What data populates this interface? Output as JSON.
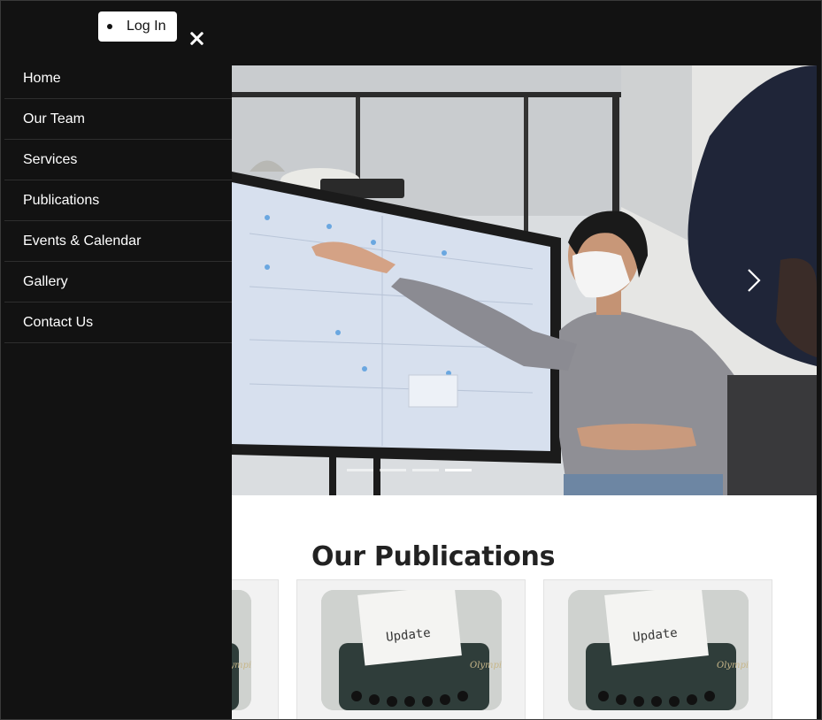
{
  "header": {
    "login_label": "Log In"
  },
  "sidebar": {
    "items": [
      {
        "label": "Home"
      },
      {
        "label": "Our Team"
      },
      {
        "label": "Services"
      },
      {
        "label": "Publications"
      },
      {
        "label": "Events & Calendar"
      },
      {
        "label": "Gallery"
      },
      {
        "label": "Contact Us"
      }
    ]
  },
  "hero": {
    "slide_count": 4,
    "active_slide": 4,
    "next_icon": "chevron-right-icon"
  },
  "publications": {
    "title": "Our Publications",
    "cards": [
      {
        "title": "",
        "image_text": ""
      },
      {
        "title": "",
        "image_text": "Update"
      },
      {
        "title": "",
        "image_text": "Update"
      }
    ]
  },
  "colors": {
    "background": "#121212",
    "content": "#ffffff",
    "card": "#f2f2f2"
  }
}
